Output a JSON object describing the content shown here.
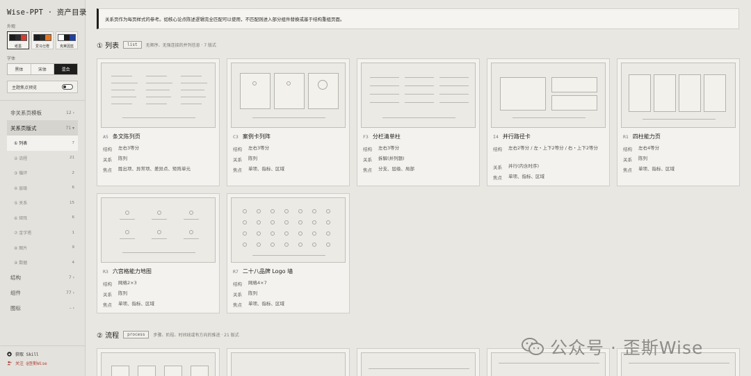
{
  "app": {
    "title": "Wise-PPT · 资产目录"
  },
  "sidebar": {
    "skin_label": "外观",
    "skins": [
      {
        "name": "纸墨",
        "colors": [
          "#1c1c1c",
          "#2b2b2b",
          "#d63a31"
        ],
        "active": true
      },
      {
        "name": "爱马仕橙",
        "colors": [
          "#1c1c1c",
          "#2b2b2b",
          "#e8741e"
        ],
        "active": false
      },
      {
        "name": "克莱因蓝",
        "colors": [
          "#ffffff",
          "#1c1c1c",
          "#1f3fa6"
        ],
        "active": false
      }
    ],
    "font_label": "字体",
    "fonts": [
      {
        "label": "黑体",
        "active": false
      },
      {
        "label": "宋体",
        "active": false
      },
      {
        "label": "混合",
        "active": true
      }
    ],
    "focus_preview_label": "主题焦点预览",
    "nav": [
      {
        "label": "非关系页模板",
        "count": "12 ›"
      },
      {
        "label": "关系页版式",
        "count": "71 ▾"
      }
    ],
    "sub": [
      {
        "label": "① 列表",
        "count": "7"
      },
      {
        "label": "② 流程",
        "count": "21"
      },
      {
        "label": "③ 循环",
        "count": "2"
      },
      {
        "label": "④ 层级",
        "count": "6"
      },
      {
        "label": "⑤ 关系",
        "count": "15"
      },
      {
        "label": "⑥ 矩阵",
        "count": "6"
      },
      {
        "label": "⑦ 金字塔",
        "count": "1"
      },
      {
        "label": "⑧ 图片",
        "count": "9"
      },
      {
        "label": "⑨ 数据",
        "count": "4"
      }
    ],
    "nav2": [
      {
        "label": "结构",
        "count": "7 ›"
      },
      {
        "label": "组件",
        "count": "77 ›"
      },
      {
        "label": "图标",
        "count": "– ›"
      }
    ],
    "footer": {
      "skill": "获取 Skill",
      "follow": "关注 @歪斯Wise"
    }
  },
  "main": {
    "notice": "关系页作为每页样式的参考。如核心论点陈述逻辑完全匹配可以使用，不匹配则进入部分组件替换或基于结构重组页面。",
    "section1": {
      "title": "① 列表",
      "tag": "list",
      "desc": "无顺序、无强连接的并列信息 · 7 版式"
    },
    "section2": {
      "title": "② 流程",
      "tag": "process",
      "desc": "步骤、阶段、时间线或有方向的推进 · 21 版式"
    },
    "meta_labels": {
      "structure": "结构",
      "relation": "关系",
      "focus": "焦点"
    },
    "cards": [
      {
        "code": "A5",
        "name": "条文陈列页",
        "structure": "左右3等分",
        "relation": "陈列",
        "focus": "胜出项、异常项、差异点、矩阵单元"
      },
      {
        "code": "C3",
        "name": "案例卡列阵",
        "structure": "左右3等分",
        "relation": "陈列",
        "focus": "单项、指标、区域"
      },
      {
        "code": "F3",
        "name": "分栏清单柱",
        "structure": "左右3等分",
        "relation": "拆解(并列题)",
        "focus": "分支、层级、局部"
      },
      {
        "code": "I4",
        "name": "并行路径卡",
        "structure": "左右2等分 / 左・上下2等分 / 右・上下2等分",
        "relation": "并行(内含时序)",
        "focus": "单项、指标、区域"
      },
      {
        "code": "R1",
        "name": "四柱能力页",
        "structure": "左右4等分",
        "relation": "陈列",
        "focus": "单项、指标、区域"
      },
      {
        "code": "R3",
        "name": "六宫格能力地图",
        "structure": "网格2×3",
        "relation": "陈列",
        "focus": "单项、指标、区域"
      },
      {
        "code": "R7",
        "name": "二十八品牌 Logo 墙",
        "structure": "网格4×7",
        "relation": "陈列",
        "focus": "单项、指标、区域"
      }
    ]
  },
  "watermark": {
    "text": "公众号 · 歪斯Wise"
  }
}
